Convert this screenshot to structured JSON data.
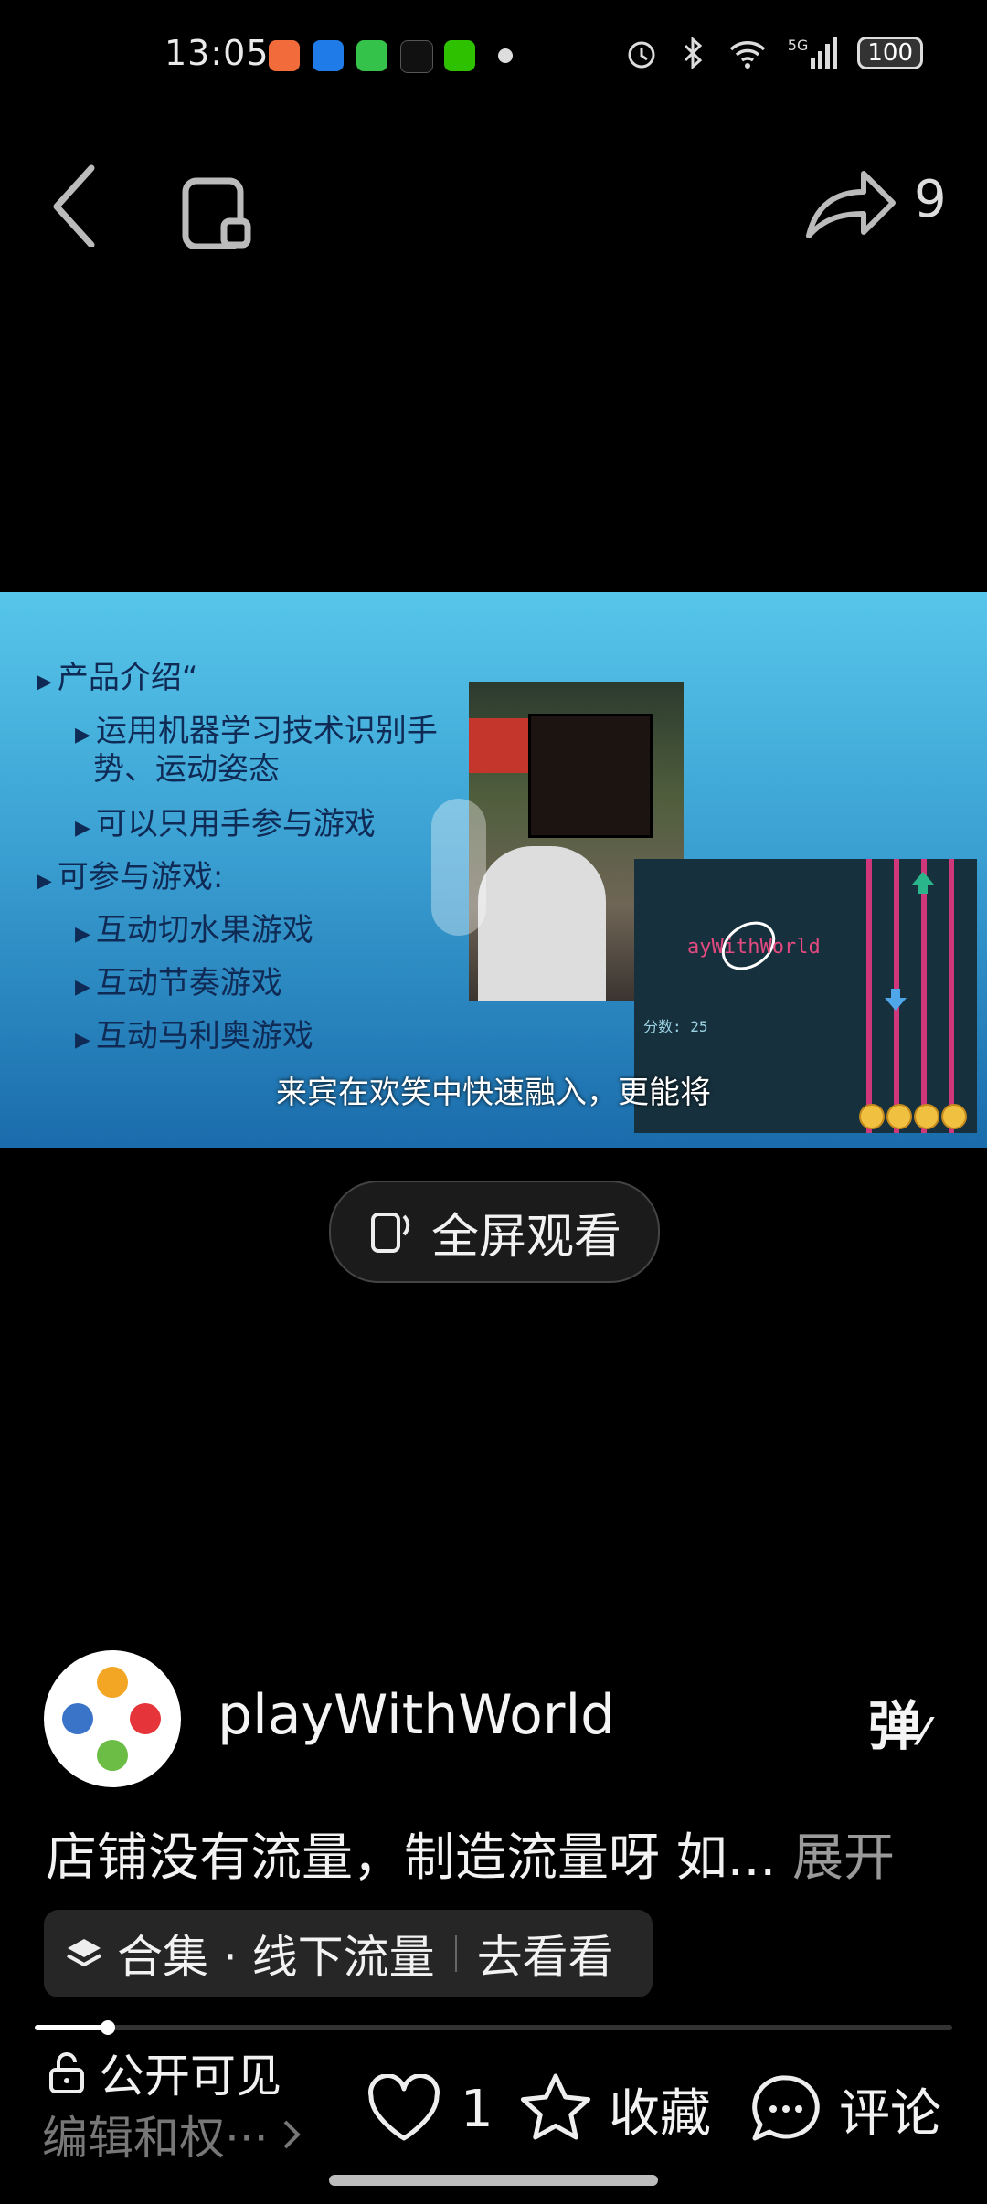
{
  "status_bar": {
    "time": "13:05",
    "network": "5G",
    "battery": "100",
    "app_badges": [
      {
        "name": "video-app-icon",
        "color": "#f26b3a"
      },
      {
        "name": "shopping-app-icon",
        "color": "#1e7be8"
      },
      {
        "name": "messages-app-icon",
        "color": "#35c24a"
      },
      {
        "name": "tiktok-app-icon",
        "color": "#111111"
      },
      {
        "name": "wechat-app-icon",
        "color": "#2dc100"
      }
    ]
  },
  "top_nav": {
    "share_count": "9"
  },
  "video": {
    "slide_lines": [
      "产品介绍“",
      "运用机器学习技术识别手",
      "势、运动姿态",
      "可以只用手参与游戏",
      "可参与游戏:",
      "互动切水果游戏",
      "互动节奏游戏",
      "互动马利奥游戏"
    ],
    "game_title": "ayWithWorld",
    "game_score": "分数: 25",
    "subtitle": "来宾在欢笑中快速融入，更能将"
  },
  "fullscreen": {
    "label": "全屏观看"
  },
  "author": {
    "name": "playWithWorld",
    "danmaku_label": "弹"
  },
  "description": {
    "text": "店铺没有流量，制造流量呀 如...",
    "expand_label": "展开"
  },
  "collection": {
    "text": "合集 · 线下流量",
    "go_label": "去看看"
  },
  "progress": {
    "fraction": 0.08
  },
  "bottom_bar": {
    "visibility_label": "公开可见",
    "edit_label": "编辑和权···",
    "like_count": "1",
    "collect_label": "收藏",
    "comment_label": "评论"
  },
  "colors": {
    "background": "#000000",
    "avatar_dots": [
      "#f2a623",
      "#e5343a",
      "#3a74c9",
      "#6cbd45"
    ]
  }
}
